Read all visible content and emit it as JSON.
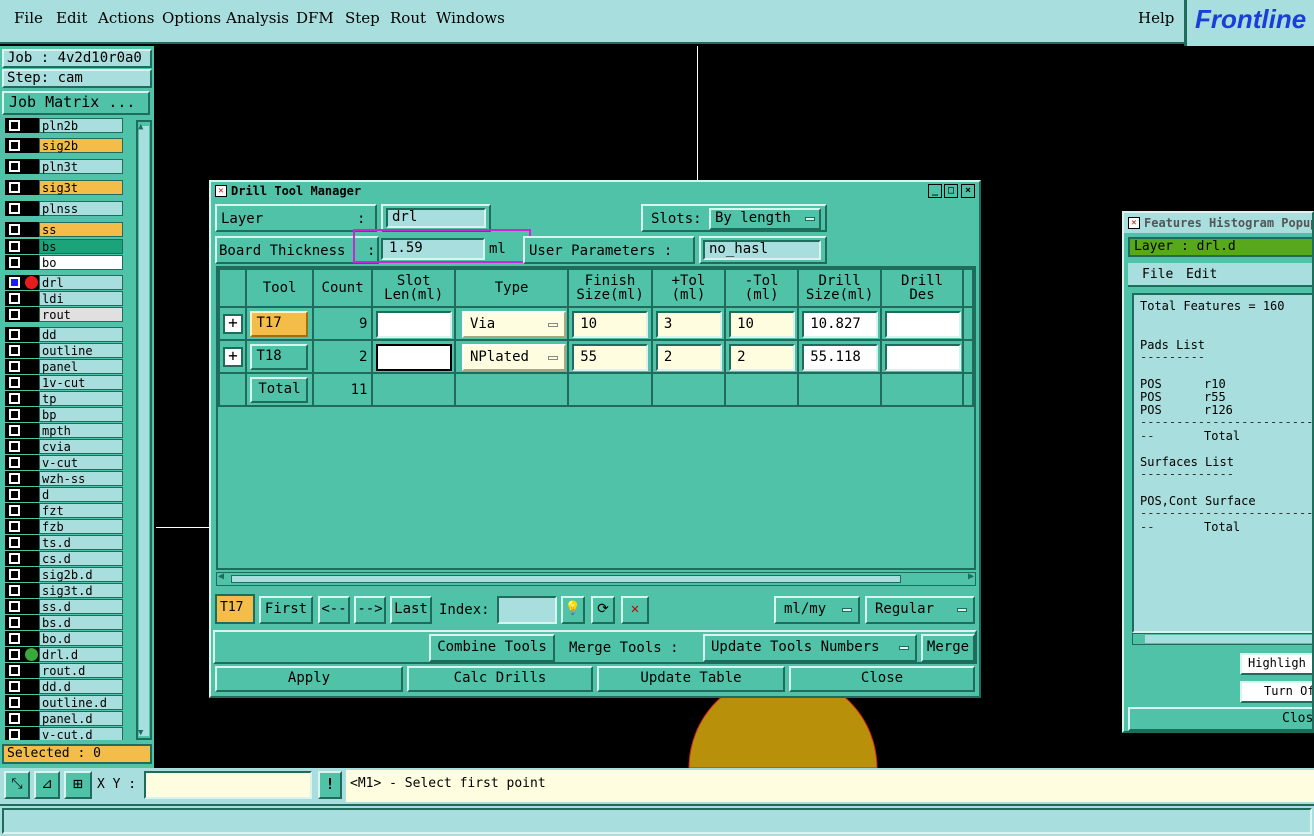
{
  "menubar": {
    "items": [
      "File",
      "Edit",
      "Actions",
      "Options",
      "Analysis",
      "DFM",
      "Step",
      "Rout",
      "Windows"
    ],
    "help": "Help",
    "logo": "Frontline"
  },
  "sidebar": {
    "job": "Job : 4v2d10r0a0",
    "step": "Step: cam",
    "job_matrix": "Job Matrix ...",
    "layers": [
      {
        "name": "pln2b",
        "color": "#a8dedd"
      },
      {
        "name": "sig2b",
        "color": "#f4bd4a"
      },
      {
        "name": "pln3t",
        "color": "#a8dedd"
      },
      {
        "name": "sig3t",
        "color": "#f4bd4a"
      },
      {
        "name": "plnss",
        "color": "#a8dedd"
      },
      {
        "name": "ss",
        "color": "#f4bd4a"
      },
      {
        "name": "bs",
        "color": "#1ba37a"
      },
      {
        "name": "bo",
        "color": "#ffffff"
      },
      {
        "name": "drl",
        "color": "#a8dedd"
      },
      {
        "name": "ldi",
        "color": "#a8dedd"
      },
      {
        "name": "rout",
        "color": "#e0e0e0"
      },
      {
        "name": "dd",
        "color": "#a8dedd"
      },
      {
        "name": "outline",
        "color": "#a8dedd"
      },
      {
        "name": "panel",
        "color": "#a8dedd"
      },
      {
        "name": "1v-cut",
        "color": "#a8dedd"
      },
      {
        "name": "tp",
        "color": "#a8dedd"
      },
      {
        "name": "bp",
        "color": "#a8dedd"
      },
      {
        "name": "mpth",
        "color": "#a8dedd"
      },
      {
        "name": "cvia",
        "color": "#a8dedd"
      },
      {
        "name": "v-cut",
        "color": "#a8dedd"
      },
      {
        "name": "wzh-ss",
        "color": "#a8dedd"
      },
      {
        "name": "d",
        "color": "#a8dedd"
      },
      {
        "name": "fzt",
        "color": "#a8dedd"
      },
      {
        "name": "fzb",
        "color": "#a8dedd"
      },
      {
        "name": "ts.d",
        "color": "#a8dedd"
      },
      {
        "name": "cs.d",
        "color": "#a8dedd"
      },
      {
        "name": "sig2b.d",
        "color": "#a8dedd"
      },
      {
        "name": "sig3t.d",
        "color": "#a8dedd"
      },
      {
        "name": "ss.d",
        "color": "#a8dedd"
      },
      {
        "name": "bs.d",
        "color": "#a8dedd"
      },
      {
        "name": "bo.d",
        "color": "#a8dedd"
      },
      {
        "name": "drl.d",
        "color": "#a8dedd"
      },
      {
        "name": "rout.d",
        "color": "#a8dedd"
      },
      {
        "name": "dd.d",
        "color": "#a8dedd"
      },
      {
        "name": "outline.d",
        "color": "#a8dedd"
      },
      {
        "name": "panel.d",
        "color": "#a8dedd"
      },
      {
        "name": "v-cut.d",
        "color": "#a8dedd"
      }
    ],
    "selected": "Selected : 0"
  },
  "dialog": {
    "title": "Drill Tool Manager",
    "layer_label": "Layer",
    "layer_colon": ":",
    "layer_value": "drl",
    "slots_label": "Slots:",
    "slots_value": "By length",
    "board_thickness_label": "Board Thickness",
    "board_thickness_colon": ":",
    "board_thickness_value": "1.59",
    "board_thickness_unit": "ml",
    "user_params_label": "User Parameters  :",
    "user_params_value": "no_hasl",
    "columns": [
      "Tool",
      "Count",
      "Slot\nLen(ml)",
      "Type",
      "Finish\nSize(ml)",
      "+Tol\n(ml)",
      "-Tol\n(ml)",
      "Drill\nSize(ml)",
      "Drill\nDes"
    ],
    "rows": [
      {
        "tool": "T17",
        "count": "9",
        "slot": "",
        "type": "Via",
        "finish": "10",
        "ptol": "3",
        "ntol": "10",
        "drill": "10.827",
        "des": ""
      },
      {
        "tool": "T18",
        "count": "2",
        "slot": "",
        "type": "NPlated",
        "finish": "55",
        "ptol": "2",
        "ntol": "2",
        "drill": "55.118",
        "des": ""
      }
    ],
    "total_label": "Total",
    "total_count": "11",
    "nav": {
      "current": "T17",
      "first": "First",
      "prev": "<--",
      "next": "-->",
      "last": "Last",
      "index_label": "Index:",
      "units": "ml/my",
      "mode": "Regular"
    },
    "combine": "Combine Tools",
    "merge_label": "Merge Tools :",
    "merge_option": "Update Tools Numbers",
    "merge": "Merge",
    "apply": "Apply",
    "calc": "Calc Drills",
    "update_table": "Update Table",
    "close": "Close"
  },
  "histogram": {
    "title": "Features Histogram Popup",
    "layer": "Layer :  drl.d",
    "file": "File",
    "edit": "Edit",
    "total_features": "Total Features = 160",
    "pads_list": "Pads List",
    "pads": [
      {
        "pol": "POS",
        "sym": "r10"
      },
      {
        "pol": "POS",
        "sym": "r55"
      },
      {
        "pol": "POS",
        "sym": "r126"
      }
    ],
    "total": "Total",
    "surfaces_list": "Surfaces List",
    "surface_row": "POS,Cont Surface",
    "highlight": "Highligh",
    "turn_off": "Turn Of",
    "close": "Close"
  },
  "bottom": {
    "xy_label": "X Y :",
    "prompt": "<M1> - Select first point"
  }
}
